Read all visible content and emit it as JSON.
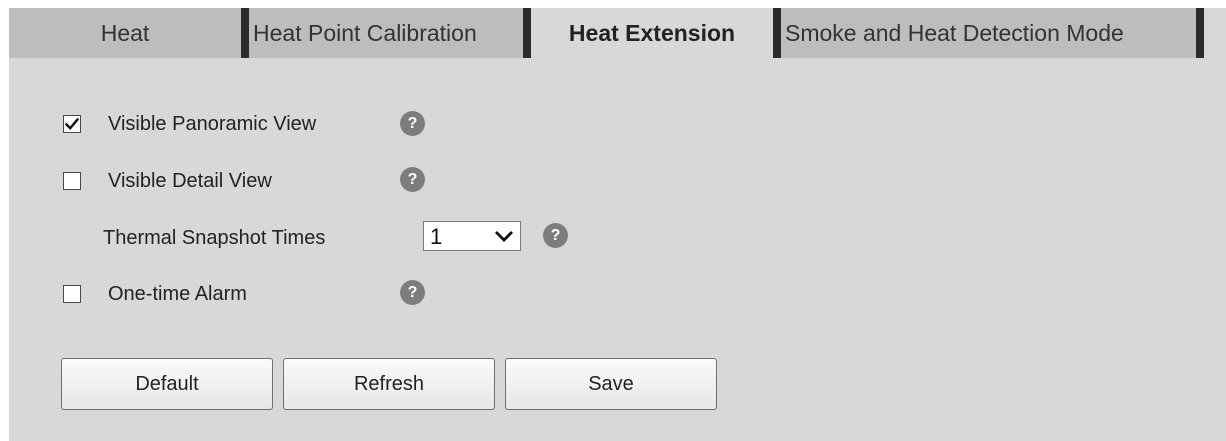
{
  "tabs": [
    {
      "label": "Heat",
      "active": false
    },
    {
      "label": "Heat Point Calibration",
      "active": false
    },
    {
      "label": "Heat Extension",
      "active": true
    },
    {
      "label": "Smoke and Heat Detection Mode",
      "active": false
    }
  ],
  "options": {
    "visible_panoramic": {
      "label": "Visible Panoramic View",
      "checked": true
    },
    "visible_detail": {
      "label": "Visible Detail View",
      "checked": false
    },
    "thermal_snapshot": {
      "label": "Thermal Snapshot Times",
      "value": "1"
    },
    "one_time_alarm": {
      "label": "One-time Alarm",
      "checked": false
    }
  },
  "help_glyph": "?",
  "buttons": {
    "default_label": "Default",
    "refresh_label": "Refresh",
    "save_label": "Save"
  },
  "colors": {
    "panel_bg": "#d8d8d8",
    "inactive_tab_bg": "#bdbdbd",
    "tab_separator": "#2b2b2b",
    "help_icon_bg": "#7d7d7d"
  }
}
